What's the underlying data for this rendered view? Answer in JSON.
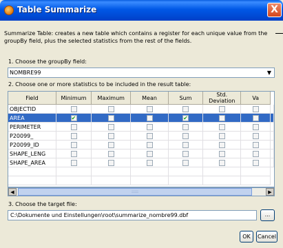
{
  "window": {
    "title": "Table Summarize",
    "close_label": "X"
  },
  "description": "Summarize Table: creates a new table which contains a register for each unique value from the groupBy field, plus the selected statistics from the rest of the fields.",
  "step1_label": "1. Choose the groupBy field:",
  "groupby_value": "NOMBRE99",
  "step2_label": "2. Choose one or more statistics to be included in the result table:",
  "table": {
    "headers": [
      "Field",
      "Minimum",
      "Maximum",
      "Mean",
      "Sum",
      "Std. Deviation",
      "Va"
    ],
    "rows": [
      {
        "field": "OBJECTID",
        "checks": [
          false,
          false,
          false,
          false,
          false,
          false
        ],
        "selected": false
      },
      {
        "field": "AREA",
        "checks": [
          true,
          false,
          false,
          true,
          false,
          false
        ],
        "selected": true
      },
      {
        "field": "PERIMETER",
        "checks": [
          false,
          false,
          false,
          false,
          false,
          false
        ],
        "selected": false
      },
      {
        "field": "P20099_",
        "checks": [
          false,
          false,
          false,
          false,
          false,
          false
        ],
        "selected": false
      },
      {
        "field": "P20099_ID",
        "checks": [
          false,
          false,
          false,
          false,
          false,
          false
        ],
        "selected": false
      },
      {
        "field": "SHAPE_LENG",
        "checks": [
          false,
          false,
          false,
          false,
          false,
          false
        ],
        "selected": false
      },
      {
        "field": "SHAPE_AREA",
        "checks": [
          false,
          false,
          false,
          false,
          false,
          false
        ],
        "selected": false
      }
    ]
  },
  "step3_label": "3. Choose the target file:",
  "target_file": "C:\\Dokumente und Einstellungen\\root\\summarize_nombre99.dbf",
  "browse_label": "...",
  "ok_label": "OK",
  "cancel_label": "Cancel"
}
